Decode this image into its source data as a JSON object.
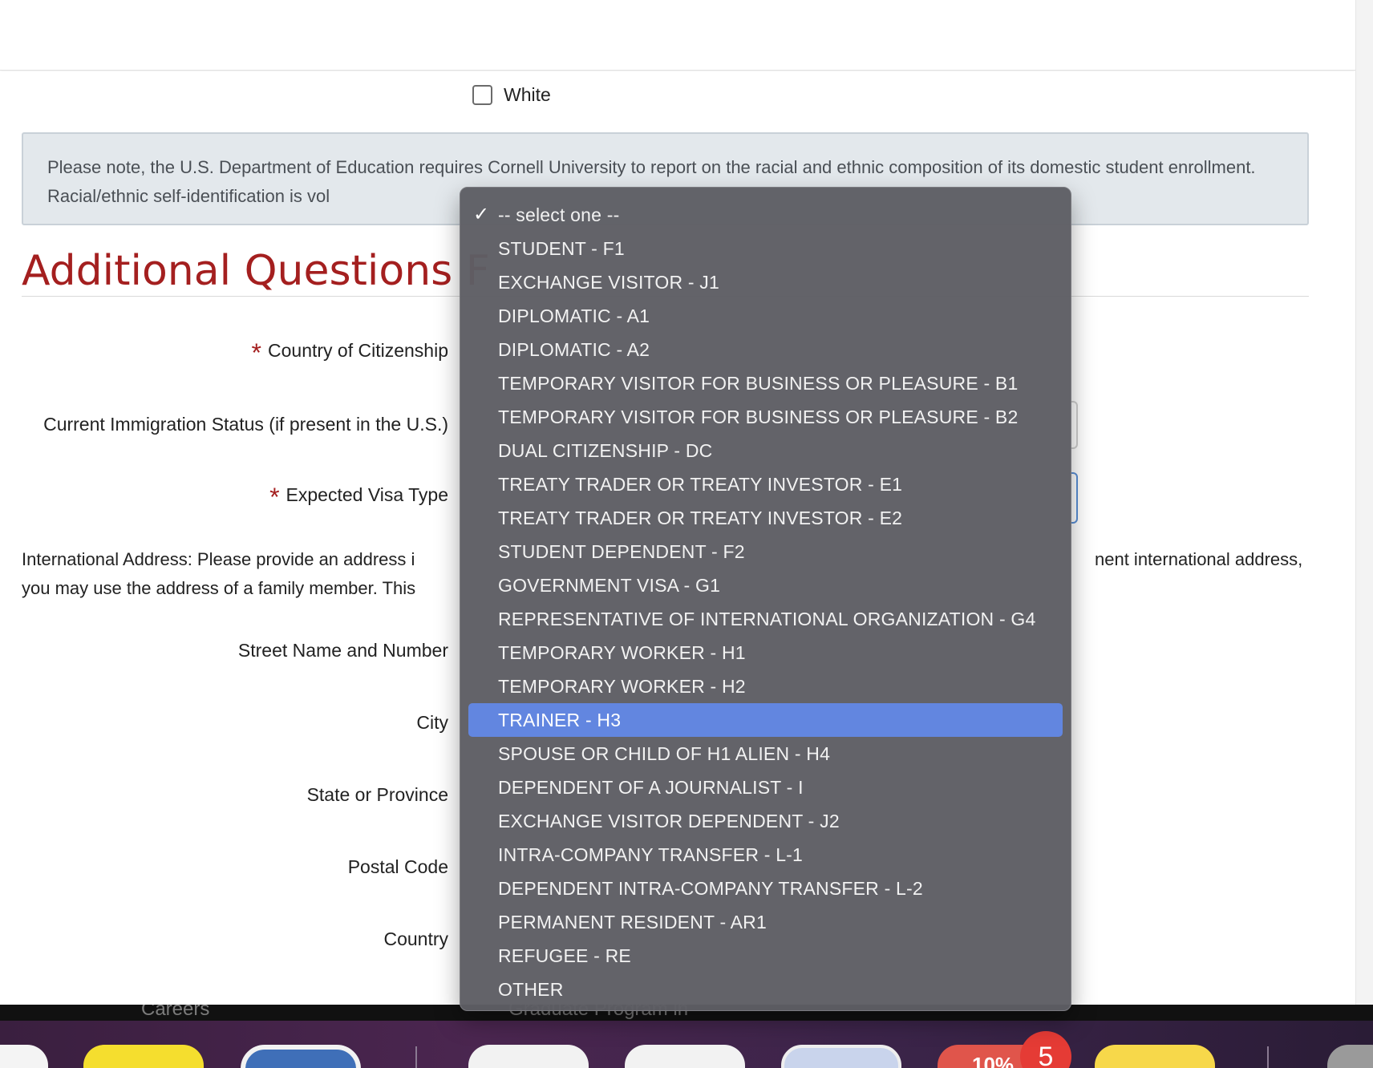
{
  "checkbox": {
    "label": "White"
  },
  "notice": {
    "text": "Please note, the U.S. Department of Education requires Cornell University to report on the racial and ethnic composition of its domestic student enrollment. Racial/ethnic self-identification is vol"
  },
  "section_title": "Additional Questions F",
  "form": {
    "required_mark": "*",
    "citizenship_label": "Country of Citizenship",
    "immigration_label": "Current Immigration Status (if present in the U.S.)",
    "visa_label": "Expected Visa Type",
    "street_label": "Street Name and Number",
    "city_label": "City",
    "state_label": "State or Province",
    "postal_label": "Postal Code",
    "country_label": "Country"
  },
  "intl_address": {
    "line1_left": "International Address: Please provide an address i",
    "line1_right": "nent international address,",
    "line2_left": "you may use the address of a family member. This "
  },
  "footer": {
    "left": "Careers",
    "mid": "Graduate Program in"
  },
  "dock": {
    "badge_count": "5",
    "badge_pre": "10%"
  },
  "visa_dropdown": {
    "checkmark": "✓",
    "selected_index": 15,
    "options": [
      "-- select one --",
      "STUDENT - F1",
      "EXCHANGE VISITOR - J1",
      "DIPLOMATIC - A1",
      "DIPLOMATIC - A2",
      "TEMPORARY VISITOR FOR BUSINESS OR PLEASURE - B1",
      "TEMPORARY VISITOR FOR BUSINESS OR PLEASURE - B2",
      "DUAL CITIZENSHIP - DC",
      "TREATY TRADER OR TREATY INVESTOR - E1",
      "TREATY TRADER OR TREATY INVESTOR - E2",
      "STUDENT DEPENDENT - F2",
      "GOVERNMENT VISA - G1",
      "REPRESENTATIVE OF INTERNATIONAL ORGANIZATION - G4",
      "TEMPORARY WORKER - H1",
      "TEMPORARY WORKER - H2",
      "TRAINER - H3",
      "SPOUSE OR CHILD OF H1 ALIEN - H4",
      "DEPENDENT OF A JOURNALIST - I",
      "EXCHANGE VISITOR DEPENDENT - J2",
      "INTRA-COMPANY TRANSFER - L-1",
      "DEPENDENT INTRA-COMPANY TRANSFER - L-2",
      "PERMANENT RESIDENT - AR1",
      "REFUGEE - RE",
      "OTHER"
    ]
  }
}
